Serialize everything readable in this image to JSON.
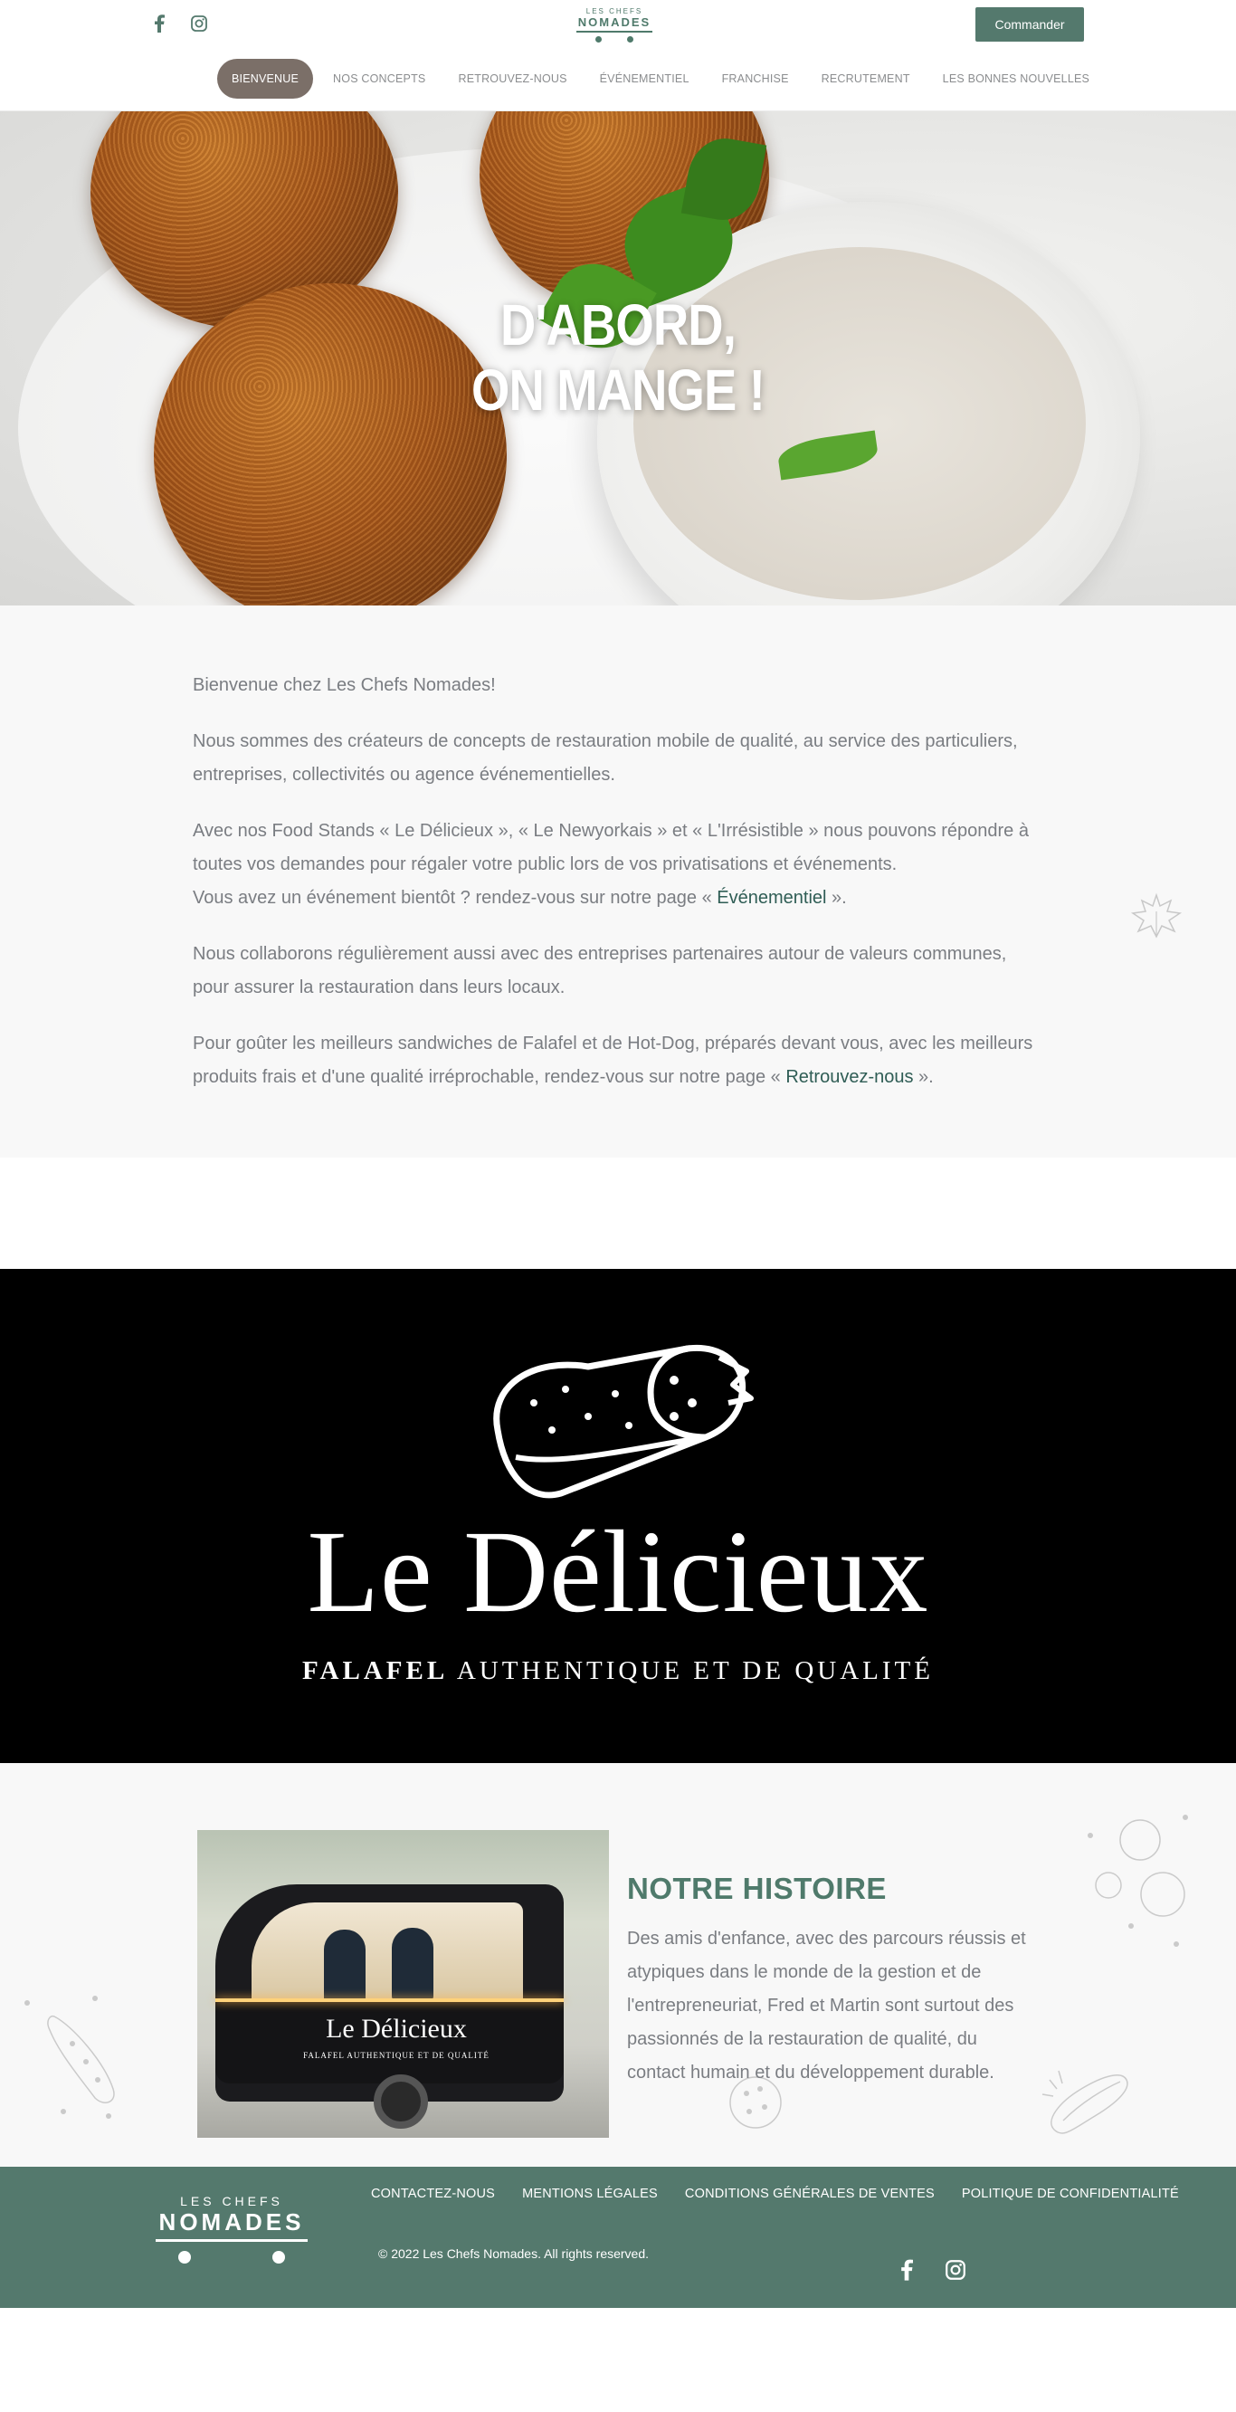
{
  "header": {
    "social": [
      {
        "icon": "facebook-icon"
      },
      {
        "icon": "instagram-icon"
      }
    ],
    "logo": {
      "line1": "LES CHEFS",
      "line2": "NOMADES"
    },
    "order_button": "Commander",
    "nav": [
      {
        "label": "BIENVENUE",
        "active": true
      },
      {
        "label": "NOS CONCEPTS"
      },
      {
        "label": "RETROUVEZ-NOUS"
      },
      {
        "label": "ÉVÉNEMENTIEL"
      },
      {
        "label": "FRANCHISE"
      },
      {
        "label": "RECRUTEMENT"
      },
      {
        "label": "LES BONNES NOUVELLES"
      }
    ]
  },
  "hero": {
    "line1": "D'ABORD,",
    "line2": "ON MANGE !"
  },
  "intro": {
    "p1": "Bienvenue chez Les Chefs Nomades!",
    "p2": "Nous sommes des créateurs de concepts de restauration mobile de qualité, au service des particuliers, entreprises, collectivités ou agence événementielles.",
    "p3a": "Avec nos Food Stands « Le Délicieux », « Le Newyorkais » et « L'Irrésistible » nous pouvons répondre à toutes vos demandes pour régaler votre public lors de vos privatisations et événements.",
    "p3b_before": "Vous avez un événement bientôt ? rendez-vous sur notre page « ",
    "p3b_link": "Événementiel",
    "p3b_after": " ».",
    "p4": "Nous collaborons régulièrement aussi avec des entreprises partenaires autour de valeurs communes, pour assurer la restauration dans leurs locaux.",
    "p5_before": "Pour goûter les meilleurs sandwiches de Falafel et de Hot-Dog, préparés devant vous, avec les meilleurs produits frais et d'une qualité irréprochable, rendez-vous sur notre page « ",
    "p5_link": "Retrouvez-nous",
    "p5_after": " »."
  },
  "banner": {
    "title": "Le Délicieux",
    "sub_bold": "FALAFEL",
    "sub_rest": "AUTHENTIQUE ET DE QUALITÉ"
  },
  "story": {
    "image_label": "Le Délicieux",
    "image_sublabel": "FALAFEL AUTHENTIQUE ET DE QUALITÉ",
    "title": "NOTRE HISTOIRE",
    "text": "Des amis d'enfance, avec des parcours réussis et atypiques dans le monde de la gestion et de l'entrepreneuriat, Fred et Martin sont surtout des passionnés de la restauration de qualité, du contact humain et du développement durable."
  },
  "footer": {
    "logo": {
      "line1": "LES CHEFS",
      "line2": "NOMADES"
    },
    "links": [
      "CONTACTEZ-NOUS",
      "MENTIONS LÉGALES",
      "CONDITIONS GÉNÉRALES DE VENTES",
      "POLITIQUE DE CONFIDENTIALITÉ"
    ],
    "copyright": "© 2022 Les Chefs Nomades. All rights reserved.",
    "social": [
      {
        "icon": "facebook-icon"
      },
      {
        "icon": "instagram-icon"
      }
    ]
  },
  "colors": {
    "brand_green": "#54796d",
    "nav_active": "#7b6f68",
    "link": "#2f5d55"
  }
}
